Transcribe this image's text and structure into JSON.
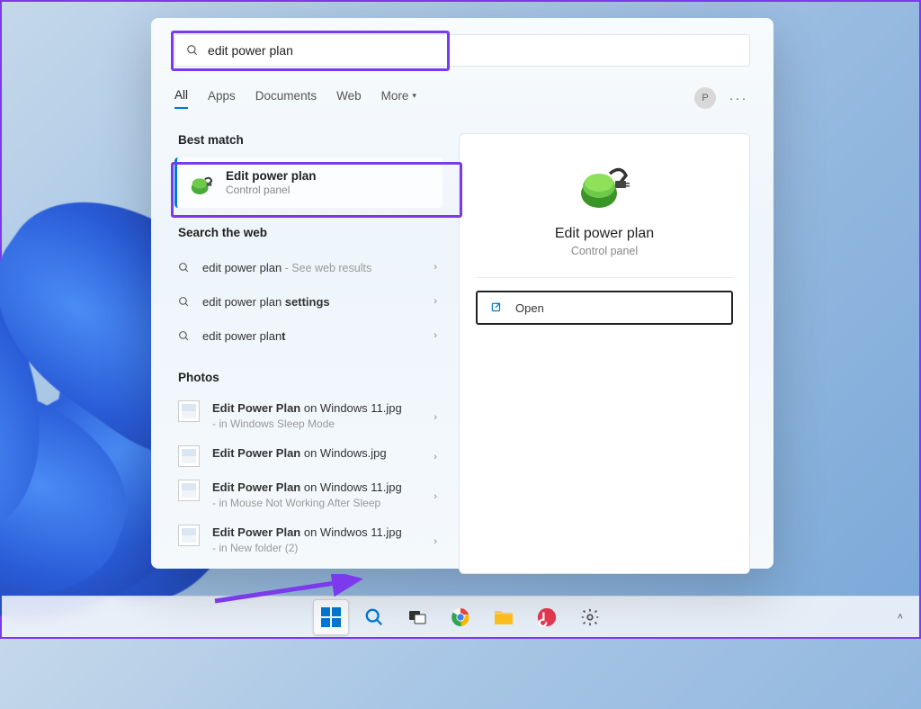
{
  "search": {
    "query": "edit power plan"
  },
  "tabs": [
    "All",
    "Apps",
    "Documents",
    "Web",
    "More"
  ],
  "avatar_initial": "P",
  "sections": {
    "best_match_title": "Best match",
    "search_web_title": "Search the web",
    "photos_title": "Photos"
  },
  "best_match": {
    "title": "Edit power plan",
    "subtitle": "Control panel"
  },
  "web_results": [
    {
      "prefix": "edit power plan",
      "suffix": " - See web results",
      "bold_suffix": false
    },
    {
      "prefix": "edit power plan ",
      "suffix": "settings",
      "bold_suffix": true
    },
    {
      "prefix": "edit power plan",
      "suffix": "t",
      "bold_suffix": true
    }
  ],
  "photos": [
    {
      "bold": "Edit Power Plan",
      "rest": " on Windows 11.jpg",
      "secondary": "- in Windows Sleep Mode"
    },
    {
      "bold": "Edit Power Plan",
      "rest": " on Windows.jpg",
      "secondary": ""
    },
    {
      "bold": "Edit Power Plan",
      "rest": " on Windows 11.jpg",
      "secondary": "- in Mouse Not Working After Sleep"
    },
    {
      "bold": "Edit Power Plan",
      "rest": " on Windwos 11.jpg",
      "secondary": "- in New folder (2)"
    }
  ],
  "detail": {
    "title": "Edit power plan",
    "subtitle": "Control panel",
    "open_label": "Open"
  },
  "colors": {
    "accent": "#0078d4",
    "highlight": "#7c3aed"
  }
}
